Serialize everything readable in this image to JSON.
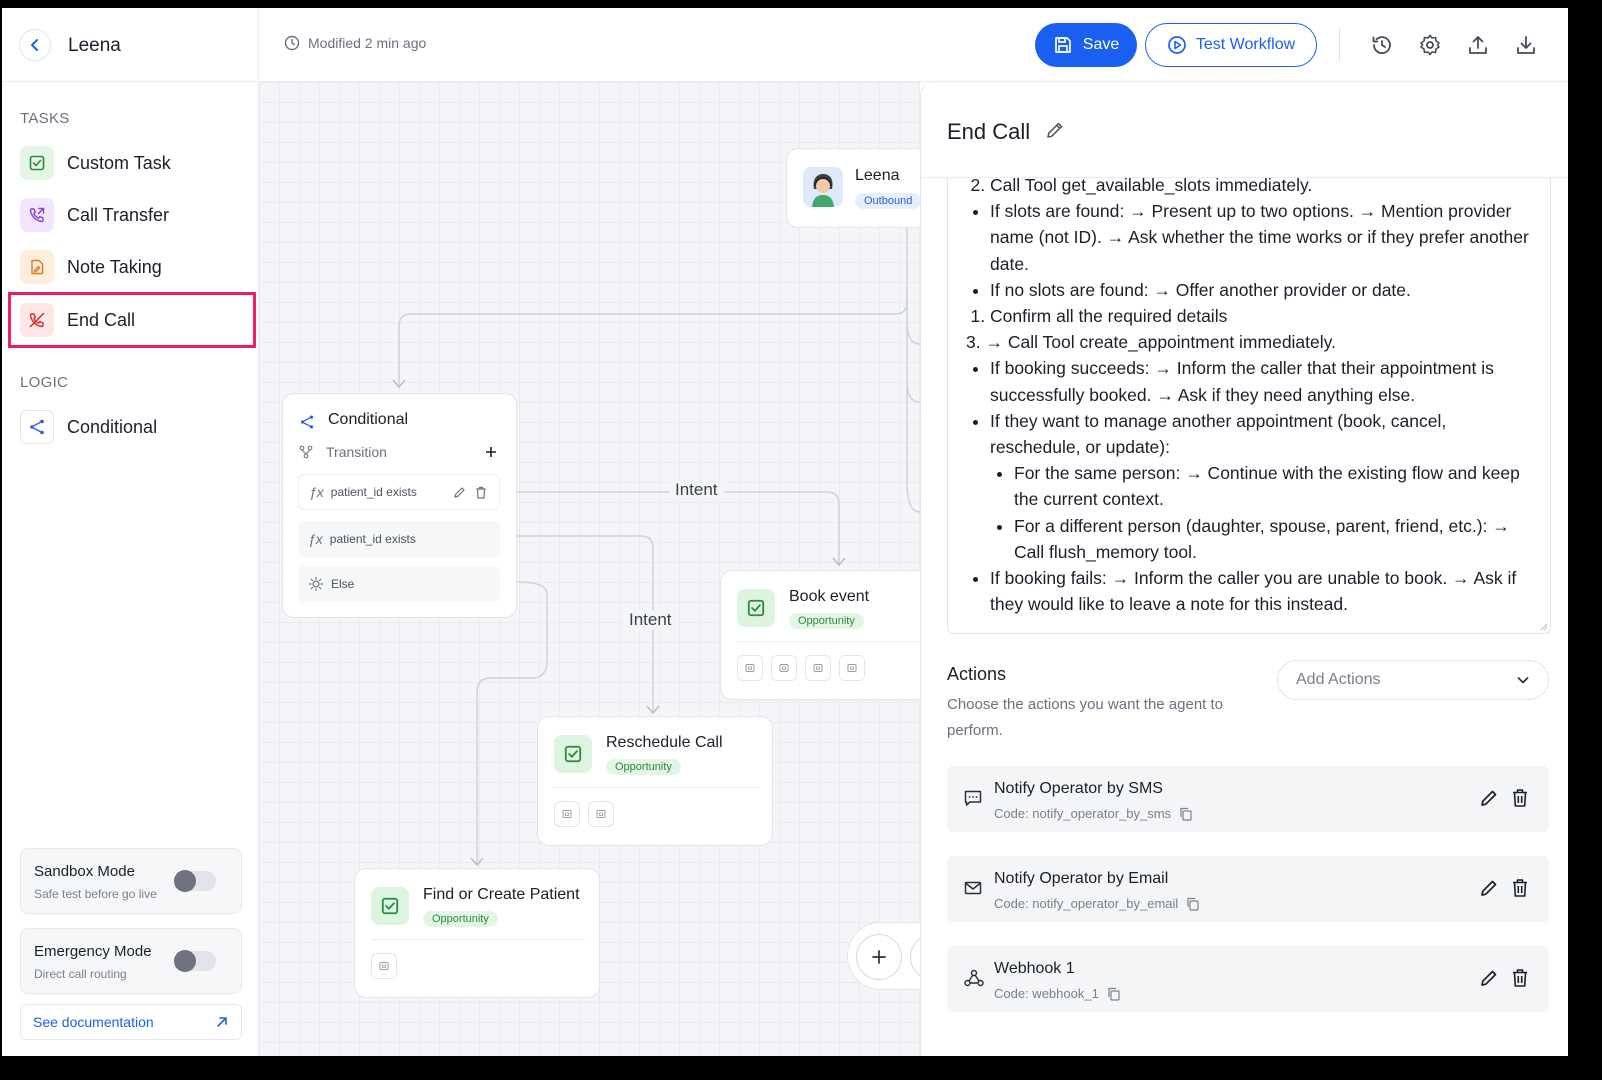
{
  "header": {
    "app_name": "Leena",
    "modified": "Modified 2 min ago",
    "save_label": "Save",
    "test_label": "Test Workflow"
  },
  "sidebar": {
    "tasks_label": "TASKS",
    "tasks": [
      {
        "label": "Custom Task",
        "icon": "check-square-icon",
        "color": "#2c8a3d",
        "bg": "#e3f6e6"
      },
      {
        "label": "Call Transfer",
        "icon": "phone-forward-icon",
        "color": "#8b3dd6",
        "bg": "#f1e6fb"
      },
      {
        "label": "Note Taking",
        "icon": "note-icon",
        "color": "#e07a1f",
        "bg": "#fdeede"
      },
      {
        "label": "End Call",
        "icon": "phone-off-icon",
        "color": "#d62b2b",
        "bg": "#fde6e6"
      }
    ],
    "logic_label": "LOGIC",
    "logic": [
      {
        "label": "Conditional",
        "icon": "branch-icon",
        "color": "#2a5fd0"
      }
    ],
    "sandbox": {
      "title": "Sandbox Mode",
      "subtitle": "Safe test before go live",
      "enabled": false
    },
    "emergency": {
      "title": "Emergency Mode",
      "subtitle": "Direct call routing",
      "enabled": false
    },
    "doc_link": "See documentation"
  },
  "canvas": {
    "agent_node": {
      "name": "Leena",
      "badge": "Outbound"
    },
    "conditional_node": {
      "title": "Conditional",
      "transition_label": "Transition",
      "rows": [
        "patient_id exists",
        "patient_id exists",
        "Else"
      ]
    },
    "wire_labels": [
      "Intent",
      "Intent"
    ],
    "task_nodes": [
      {
        "title": "Book event",
        "badge": "Opportunity"
      },
      {
        "title": "Reschedule Call",
        "badge": "Opportunity"
      },
      {
        "title": "Find or Create Patient",
        "badge": "Opportunity"
      }
    ]
  },
  "panel": {
    "title": "End Call",
    "instructions": {
      "step2": "Call Tool get_available_slots immediately.",
      "step2_bullets": [
        "If slots are found: → Present up to two options. → Mention provider name (not ID). → Ask whether the time works or if they prefer another date.",
        "If no slots are found: → Offer another provider or date."
      ],
      "confirm": "Confirm all the required details",
      "step3": "→ Call Tool create_appointment immediately.",
      "step3_b1": "If booking succeeds: → Inform the caller that their appointment is successfully booked. → Ask if they need anything else.",
      "step3_b2": "If they want to manage another appointment (book, cancel, reschedule, or update):",
      "step3_b2_sub": [
        "For the same person: → Continue with the existing flow and keep the current context.",
        "For a different person (daughter, spouse, parent, friend, etc.): → Call flush_memory tool."
      ],
      "step3_b3": "If booking fails: → Inform the caller you are unable to book. → Ask if they would like to leave a note for this instead."
    },
    "actions_title": "Actions",
    "actions_desc": "Choose the actions you want the agent to perform.",
    "add_actions_placeholder": "Add Actions",
    "actions": [
      {
        "name": "Notify Operator by SMS",
        "code": "Code: notify_operator_by_sms",
        "icon": "message-icon"
      },
      {
        "name": "Notify Operator by Email",
        "code": "Code: notify_operator_by_email",
        "icon": "mail-icon"
      },
      {
        "name": "Webhook 1",
        "code": "Code: webhook_1",
        "icon": "webhook-icon"
      }
    ]
  },
  "colors": {
    "primary": "#1a5ff0",
    "highlight": "#ee1f5c"
  }
}
